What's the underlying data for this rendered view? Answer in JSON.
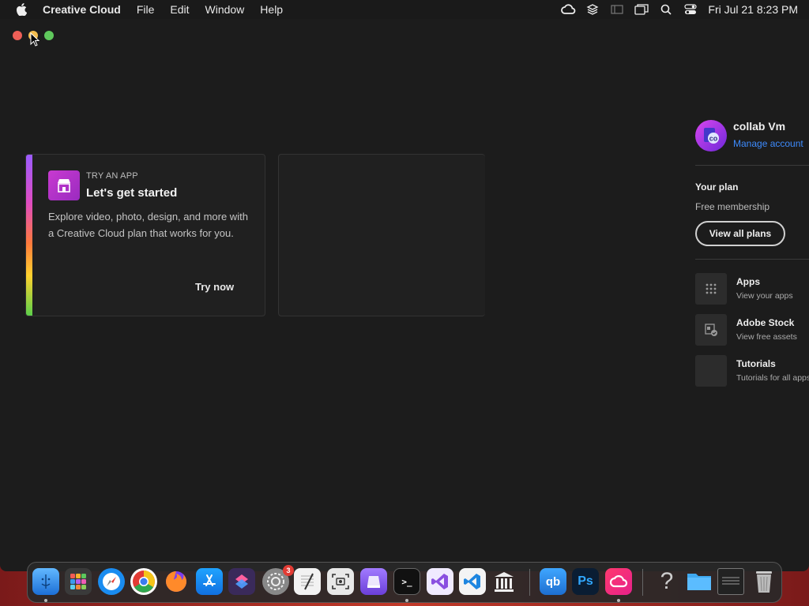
{
  "menubar": {
    "app_name": "Creative Cloud",
    "menus": [
      "File",
      "Edit",
      "Window",
      "Help"
    ],
    "clock": "Fri Jul 21  8:23 PM",
    "status_icons": [
      "creative-cloud-icon",
      "layers-icon",
      "sidebar-icon",
      "window-icon",
      "search-icon",
      "control-center-icon"
    ]
  },
  "card": {
    "eyebrow": "TRY AN APP",
    "title": "Let's get started",
    "description": "Explore video, photo, design, and more with a Creative Cloud plan that works for you.",
    "cta": "Try now"
  },
  "account": {
    "name": "collab Vm",
    "manage": "Manage account"
  },
  "plan": {
    "heading": "Your plan",
    "name": "Free membership",
    "button": "View all plans"
  },
  "sidebar": {
    "items": [
      {
        "label": "Apps",
        "sub": "View your apps",
        "icon": "grid-icon"
      },
      {
        "label": "Adobe Stock",
        "sub": "View free assets",
        "icon": "stock-icon"
      },
      {
        "label": "Tutorials",
        "sub": "Tutorials for all apps",
        "icon": "tutorials-icon"
      }
    ]
  },
  "dock": {
    "badge_count": "3",
    "ps_label": "Ps",
    "qb_label": "qb",
    "help_label": "?",
    "terminal_label": ">_"
  },
  "colors": {
    "accent_link": "#3d8bfd",
    "window_bg": "#1c1c1c"
  }
}
